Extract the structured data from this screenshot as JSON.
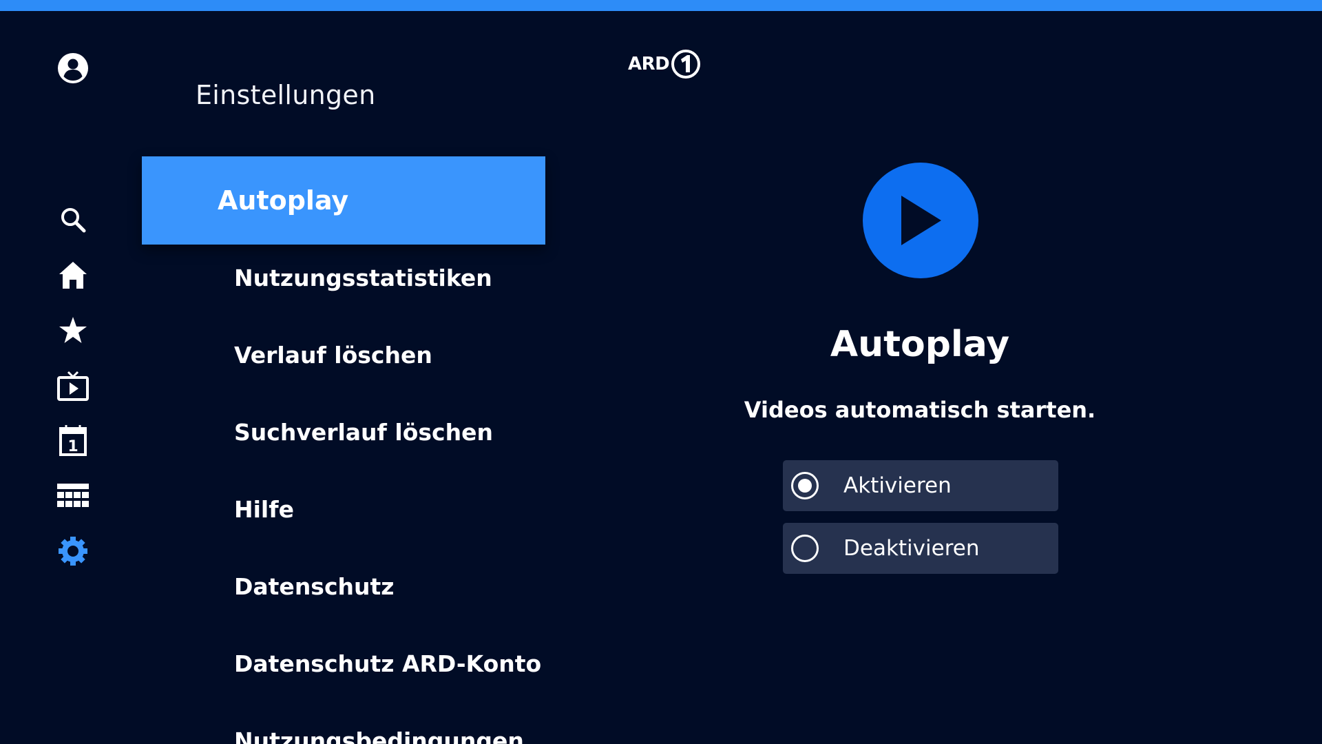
{
  "header": {
    "page_title": "Einstellungen",
    "logo_text": "ARD"
  },
  "colors": {
    "top_bar": "#2d8cf7",
    "background": "#010c26",
    "active_item": "#3a95fd",
    "play_circle": "#0d6ef0",
    "option_bg": "#26324f",
    "settings_icon": "#3a95fd"
  },
  "sidebar": {
    "icons": [
      "profile-icon",
      "search-icon",
      "home-icon",
      "star-icon",
      "tv-icon",
      "calendar-icon",
      "grid-icon",
      "gear-icon"
    ],
    "active_icon": "gear-icon"
  },
  "menu": {
    "items": [
      {
        "label": "Autoplay",
        "active": true
      },
      {
        "label": "Nutzungsstatistiken",
        "active": false
      },
      {
        "label": "Verlauf löschen",
        "active": false
      },
      {
        "label": "Suchverlauf löschen",
        "active": false
      },
      {
        "label": "Hilfe",
        "active": false
      },
      {
        "label": "Datenschutz",
        "active": false
      },
      {
        "label": "Datenschutz ARD-Konto",
        "active": false
      },
      {
        "label": "Nutzungsbedingungen",
        "active": false
      }
    ]
  },
  "detail": {
    "icon": "play-icon",
    "title": "Autoplay",
    "description": "Videos automatisch starten.",
    "options": [
      {
        "label": "Aktivieren",
        "selected": true
      },
      {
        "label": "Deaktivieren",
        "selected": false
      }
    ]
  }
}
